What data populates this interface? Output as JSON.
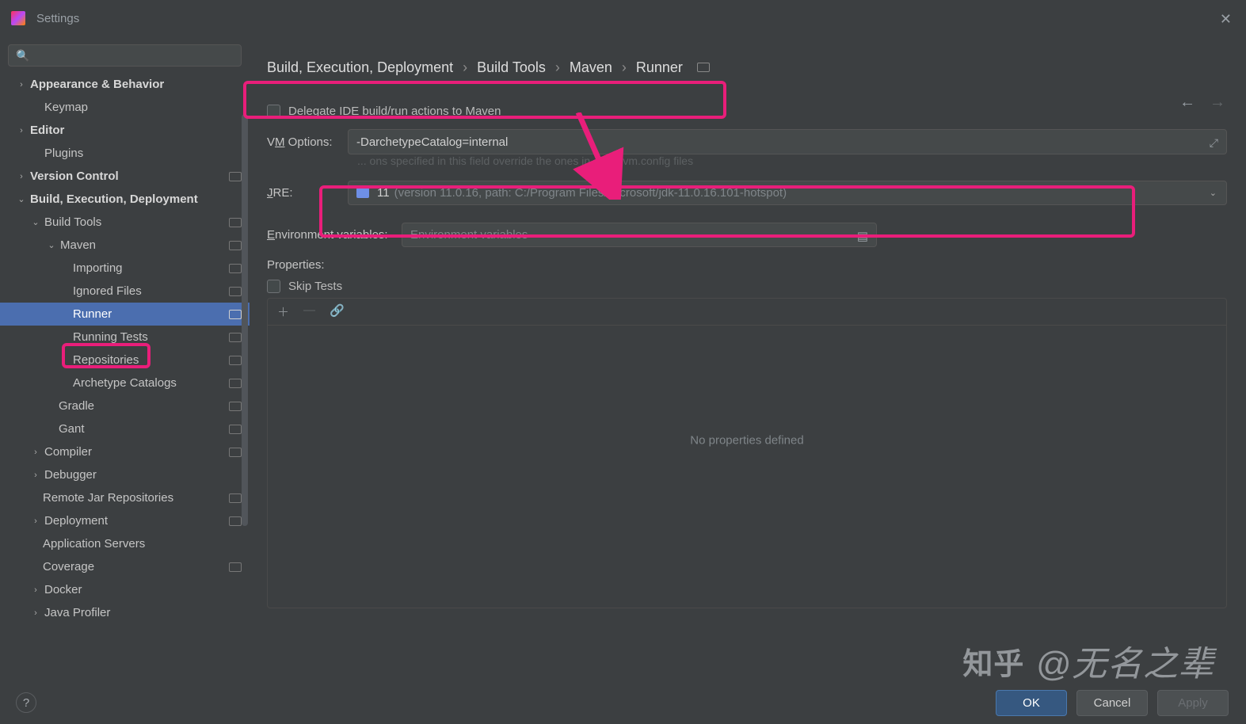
{
  "window": {
    "title": "Settings"
  },
  "search": {
    "placeholder": ""
  },
  "tree": {
    "appearance": "Appearance & Behavior",
    "keymap": "Keymap",
    "editor": "Editor",
    "plugins": "Plugins",
    "vcs": "Version Control",
    "bed": "Build, Execution, Deployment",
    "buildtools": "Build Tools",
    "maven": "Maven",
    "importing": "Importing",
    "ignored": "Ignored Files",
    "runner": "Runner",
    "runtests": "Running Tests",
    "repos": "Repositories",
    "arch": "Archetype Catalogs",
    "gradle": "Gradle",
    "gant": "Gant",
    "compiler": "Compiler",
    "debugger": "Debugger",
    "remotejar": "Remote Jar Repositories",
    "deployment": "Deployment",
    "appservers": "Application Servers",
    "coverage": "Coverage",
    "docker": "Docker",
    "javaprof": "Java Profiler"
  },
  "breadcrumb": {
    "p1": "Build, Execution, Deployment",
    "p2": "Build Tools",
    "p3": "Maven",
    "p4": "Runner"
  },
  "form": {
    "delegate": "Delegate IDE build/run actions to Maven",
    "vm_label_pre": "V",
    "vm_label_u": "M",
    "vm_label_post": " Options:",
    "vm_value": "-DarchetypeCatalog=internal",
    "vm_help": "... ons specified in this field override the ones in .mvn/jvm.config files",
    "jre_label_u": "J",
    "jre_label_post": "RE:",
    "jre_ver": "11",
    "jre_path": "(version 11.0.16, path: C:/Program Files/Microsoft/jdk-11.0.16.101-hotspot)",
    "env_label_u": "E",
    "env_label_post": "nvironment variables:",
    "env_placeholder": "Environment variables",
    "props_label": "Properties:",
    "skip_tests": "Skip Tests",
    "props_empty": "No properties defined"
  },
  "buttons": {
    "ok": "OK",
    "cancel": "Cancel",
    "apply": "Apply"
  },
  "watermark": {
    "zh": "知乎",
    "txt": "@无名之辈"
  }
}
